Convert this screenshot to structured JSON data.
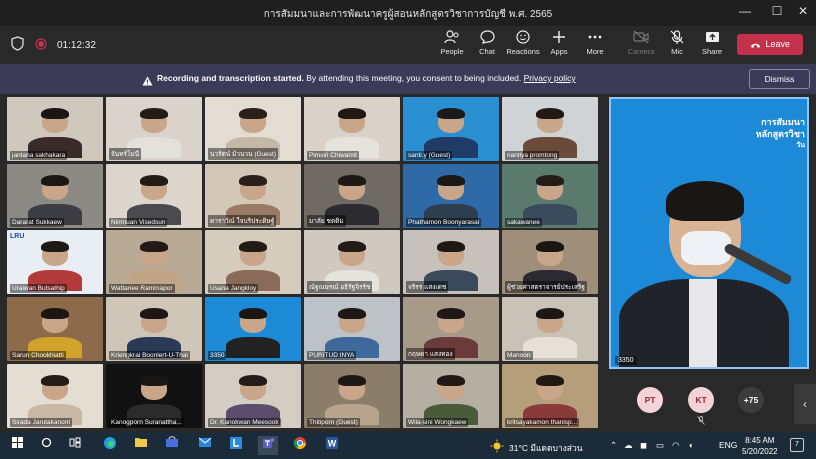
{
  "window": {
    "title": "การสัมมนาและการพัฒนาครูผู้สอนหลักสูตรวิชาการบัญชี พ.ศ. 2565",
    "minimize": "—",
    "maximize": "☐",
    "close": "✕"
  },
  "toolbar": {
    "timer": "01:12:32",
    "people": "People",
    "chat": "Chat",
    "reactions": "Reactions",
    "apps": "Apps",
    "more": "More",
    "camera": "Camera",
    "mic": "Mic",
    "share": "Share",
    "leave": "Leave"
  },
  "banner": {
    "bold": "Recording and transcription started.",
    "text": " By attending this meeting, you consent to being included. ",
    "link": "Privacy policy",
    "dismiss": "Dismiss"
  },
  "participants": [
    {
      "name": "Adisak Fonhakaew",
      "bg": "#bdb7ae",
      "hair": "#1d1a18",
      "shirt": "#2c3e6a"
    },
    {
      "name": "Pailin Trongmateerut",
      "bg": "#c9c4bf",
      "hair": "#241c18",
      "shirt": "#2b2b2b"
    },
    {
      "name": "นวรัตน์ ม้วนวน (Guest)",
      "bg": "#e2dcd2",
      "hair": "#2a2019",
      "shirt": "#c4b8a8"
    },
    {
      "name": "Pimsiri Chiwamit",
      "bg": "#d8d2c8",
      "hair": "#1f1815",
      "shirt": "#e6e3de"
    },
    {
      "name": "santi.y (Guest)",
      "bg": "#2a8fd0",
      "hair": "#1a1a1a",
      "shirt": "#1f3b66"
    },
    {
      "name": "nantiya promtong",
      "bg": "#cfd3d6",
      "hair": "#201915",
      "shirt": "#6b4a3a"
    },
    {
      "name": "Dararat Sukkaew",
      "bg": "#8b8a85",
      "hair": "#1b1715",
      "shirt": "#3c3d42"
    },
    {
      "name": "Nimnuan Visedsun",
      "bg": "#dcd6cc",
      "hair": "#221b17",
      "shirt": "#4a4a4f"
    },
    {
      "name": "ดาราวัณ์ ใจบริประดิษฐ์",
      "bg": "#d3c7b8",
      "hair": "#2a1f1a",
      "shirt": "#9a7a64"
    },
    {
      "name": "มาลัย ชตติม",
      "bg": "#6f6a64",
      "hair": "#1c1816",
      "shirt": "#2b2b30"
    },
    {
      "name": "Phathamon Boonyarasai",
      "bg": "#2f6aa8",
      "hair": "#1b1816",
      "shirt": "#2e3e4e"
    },
    {
      "name": "sakawanee",
      "bg": "#5b7a6e",
      "hair": "#231c18",
      "shirt": "#3b4b5b"
    },
    {
      "name": "Uraiwan Butsathip",
      "bg": "#e9eef4",
      "hair": "#201a17",
      "shirt": "#b33a3a",
      "lru": "LRU"
    },
    {
      "name": "Wattanee Rammapor",
      "bg": "#b9aa96",
      "hair": "#221a16",
      "shirt": "#c2a487"
    },
    {
      "name": "Usana Jangkloy",
      "bg": "#d6ccbe",
      "hair": "#231b16",
      "shirt": "#8a6a58"
    },
    {
      "name": "ณัฐณษรณ์ อธิรัฐจิรรัช",
      "bg": "#cfc9c0",
      "hair": "#211a16",
      "shirt": "#e6e2dc"
    },
    {
      "name": "จริรร แสงเดช",
      "bg": "#c6c1ba",
      "hair": "#1e1815",
      "shirt": "#3a4a5a"
    },
    {
      "name": "ผู้ช่วยศาสตราจารย์ประเสริฐ",
      "bg": "#9e8e7a",
      "hair": "#1a1614",
      "shirt": "#2a2a30"
    },
    {
      "name": "Sarun Chookhiatti",
      "bg": "#8d6b4a",
      "hair": "#1b1614",
      "shirt": "#d1a32a"
    },
    {
      "name": "Kriengkrai Boonlert-U-Thai",
      "bg": "#cfc6b8",
      "hair": "#1c1715",
      "shirt": "#2c3a5a"
    },
    {
      "name": "3350",
      "bg": "#1c8ad6",
      "hair": "#1a1614",
      "shirt": "#222"
    },
    {
      "name": "PURITUD INYA",
      "bg": "#bcc2c8",
      "hair": "#1c1816",
      "shirt": "#3d6a9a"
    },
    {
      "name": "กฤษดา แสงทอง",
      "bg": "#a89a88",
      "hair": "#1e1816",
      "shirt": "#6b3a3a"
    },
    {
      "name": "Manoon",
      "bg": "#c9c2b6",
      "hair": "#1c1715",
      "shirt": "#e5e1d9"
    },
    {
      "name": "Sirada Jarutakanont",
      "bg": "#e4ddd2",
      "hair": "#241c17",
      "shirt": "#c9b7a5"
    },
    {
      "name": "Kanogporn Suranattha...",
      "bg": "#111111",
      "hair": "#1a1614",
      "shirt": "#2b2b2b"
    },
    {
      "name": "Dr. Kanokwan Meesook",
      "bg": "#d4cdc4",
      "hair": "#231c18",
      "shirt": "#5d4d6d"
    },
    {
      "name": "Thitiporn (Guest)",
      "bg": "#8c7d6b",
      "hair": "#1d1815",
      "shirt": "#b8a58e"
    },
    {
      "name": "Wila-sini Wongkaew",
      "bg": "#b5aea3",
      "hair": "#201a17",
      "shirt": "#4a5a3a"
    },
    {
      "name": "kritsayakamon thanisp...",
      "bg": "#b59e7a",
      "hair": "#1f1915",
      "shirt": "#8a3a3a"
    },
    {
      "name": "jantana sakhakara",
      "bg": "#cfc8bd",
      "hair": "#1a1614",
      "shirt": "#3a2a2a"
    },
    {
      "name": "จันทร์โมนี",
      "bg": "#d9d3cb",
      "hair": "#221b17",
      "shirt": "#e4e0da"
    }
  ],
  "speaker": {
    "name": "3350",
    "text1": "การสัมมนา",
    "text2": "หลักสูตรวิชา",
    "text3": "วัน"
  },
  "avatars": [
    {
      "initials": "PT",
      "bg": "#f3d3d8",
      "fg": "#9a2a3a"
    },
    {
      "initials": "KT",
      "bg": "#f3d3d8",
      "fg": "#9a2a3a"
    },
    {
      "initials": "+75",
      "bg": "#3d3d3d",
      "fg": "#ffffff"
    }
  ],
  "taskbar": {
    "weather": "31°C มีแดดบางส่วน",
    "lang": "ENG",
    "time": "8:45 AM",
    "date": "5/20/2022",
    "notif": "7"
  }
}
